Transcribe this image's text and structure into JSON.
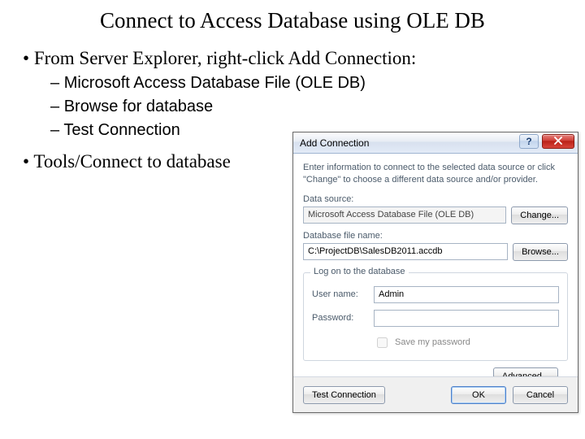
{
  "slide": {
    "title": "Connect to Access Database using OLE DB",
    "bullets": {
      "b1": "From Server Explorer, right-click Add Connection:",
      "sub1": "Microsoft Access Database File (OLE DB)",
      "sub2": "Browse for database",
      "sub3": "Test Connection",
      "b2": "Tools/Connect to database"
    }
  },
  "dialog": {
    "title": "Add Connection",
    "help": "?",
    "instruction": "Enter information to connect to the selected data source or click \"Change\" to choose a different data source and/or provider.",
    "datasource_label": "Data source:",
    "datasource_value": "Microsoft Access Database File (OLE DB)",
    "change_btn": "Change...",
    "filename_label": "Database file name:",
    "filename_value": "C:\\ProjectDB\\SalesDB2011.accdb",
    "browse_btn": "Browse...",
    "logon_legend": "Log on to the database",
    "username_label": "User name:",
    "username_value": "Admin",
    "password_label": "Password:",
    "password_value": "",
    "save_pw_label": "Save my password",
    "advanced_btn": "Advanced...",
    "test_btn": "Test Connection",
    "ok_btn": "OK",
    "cancel_btn": "Cancel"
  }
}
